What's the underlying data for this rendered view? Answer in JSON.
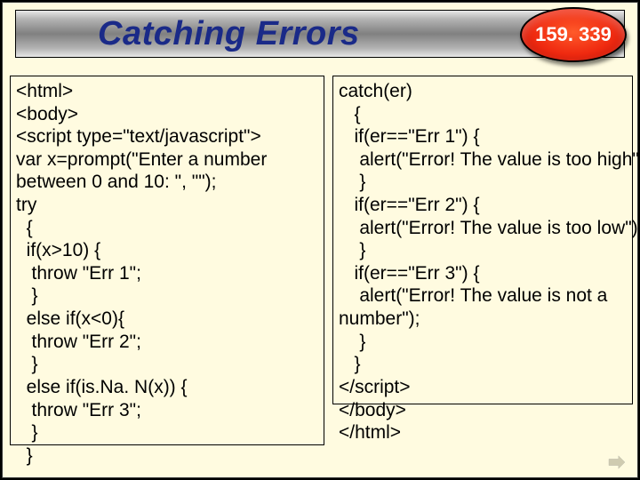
{
  "header": {
    "title": "Catching Errors",
    "badge": "159. 339"
  },
  "code": {
    "left": "<html>\n<body>\n<script type=\"text/javascript\">\nvar x=prompt(\"Enter a number\nbetween 0 and 10: \", \"\");\ntry\n  {\n  if(x>10) {\n   throw \"Err 1\";\n   }\n  else if(x<0){\n   throw \"Err 2\";\n   }\n  else if(is.Na. N(x)) {\n   throw \"Err 3\";\n   }\n  }",
    "right": "catch(er)\n   {\n   if(er==\"Err 1\") {\n    alert(\"Error! The value is too high\");\n    }\n   if(er==\"Err 2\") {\n    alert(\"Error! The value is too low\");\n    }\n   if(er==\"Err 3\") {\n    alert(\"Error! The value is not a\nnumber\");\n    }\n   }\n</script>\n</body>\n</html>"
  }
}
